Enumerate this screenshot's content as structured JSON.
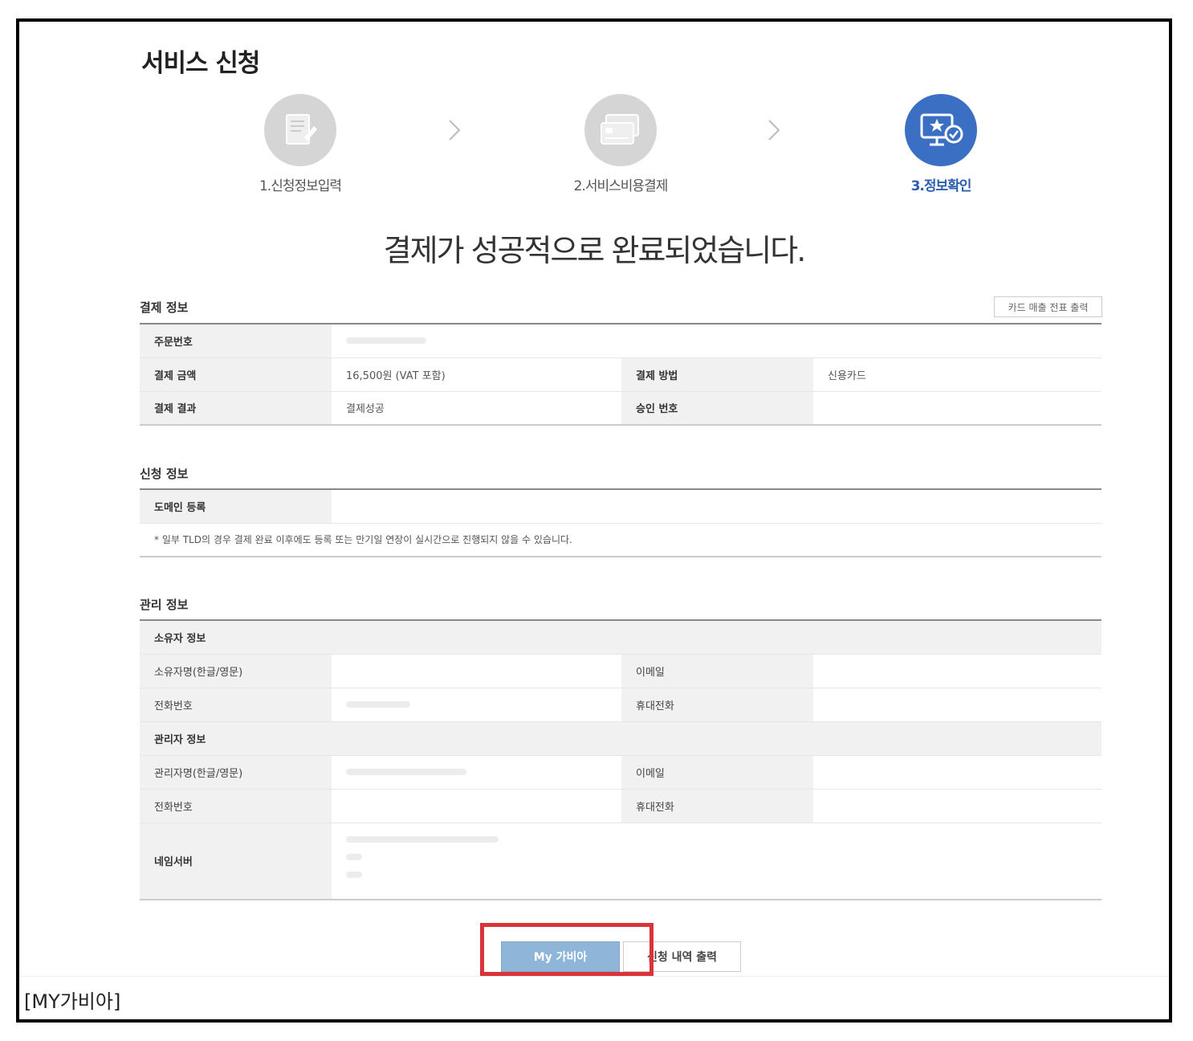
{
  "page_title": "서비스 신청",
  "steps": [
    {
      "label": "1.신청정보입력",
      "icon": "document-edit-icon",
      "state": "done"
    },
    {
      "label": "2.서비스비용결제",
      "icon": "credit-card-icon",
      "state": "done"
    },
    {
      "label": "3.정보확인",
      "icon": "monitor-star-check-icon",
      "state": "active"
    }
  ],
  "headline": "결제가 성공적으로 완료되었습니다.",
  "payment_info": {
    "title": "결제 정보",
    "card_receipt_button": "카드 매출 전표 출력",
    "order_number_label": "주문번호",
    "amount_label": "결제 금액",
    "amount_value": "16,500원 (VAT 포함)",
    "method_label": "결제 방법",
    "method_value": "신용카드",
    "result_label": "결제 결과",
    "result_value": "결제성공",
    "approval_label": "승인 번호"
  },
  "application_info": {
    "title": "신청 정보",
    "domain_label": "도메인 등록",
    "note": "* 일부 TLD의 경우 결제 완료 이후에도 등록 또는 만기일 연장이 실시간으로 진행되지 않을 수 있습니다."
  },
  "management_info": {
    "title": "관리 정보",
    "owner_section": "소유자 정보",
    "owner_name_label": "소유자명(한글/영문)",
    "owner_email_label": "이메일",
    "owner_phone_label": "전화번호",
    "owner_mobile_label": "휴대전화",
    "admin_section": "관리자 정보",
    "admin_name_label": "관리자명(한글/영문)",
    "admin_email_label": "이메일",
    "admin_phone_label": "전화번호",
    "admin_mobile_label": "휴대전화",
    "nameserver_label": "네임서버"
  },
  "buttons": {
    "my_gabia": "My 가비아",
    "print_history": "신청 내역 출력"
  },
  "caption": "[MY가비아]",
  "colors": {
    "accent": "#3a6fc4",
    "highlight": "#d9343a",
    "my_button": "#8fb6d8"
  }
}
